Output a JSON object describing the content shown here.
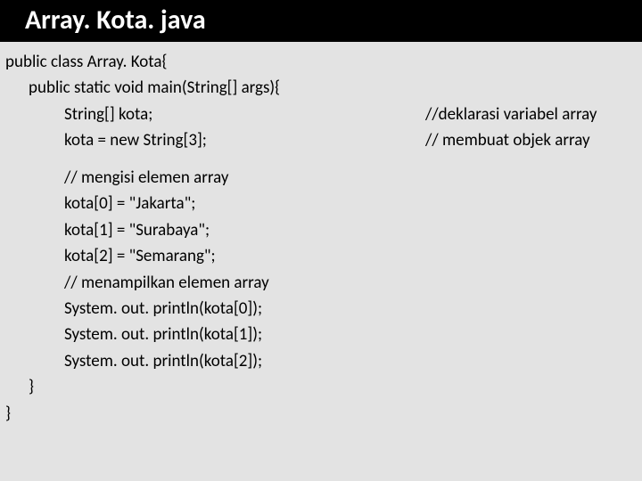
{
  "title": "Array. Kota. java",
  "lines": {
    "l0": "public class Array. Kota{",
    "l1": "public static void main(String[] args){",
    "l2_left": "String[] kota;",
    "l2_right": "//deklarasi variabel array",
    "l3_left": "kota = new String[3];",
    "l3_right": "// membuat objek array",
    "l4": "// mengisi elemen array",
    "l5": "kota[0] = \"Jakarta\";",
    "l6": "kota[1] = \"Surabaya\";",
    "l7": "kota[2] = \"Semarang\";",
    "l8": "// menampilkan elemen array",
    "l9": "System. out. println(kota[0]);",
    "l10": "System. out. println(kota[1]);",
    "l11": "System. out. println(kota[2]);",
    "l12": "}",
    "l13": "}"
  }
}
